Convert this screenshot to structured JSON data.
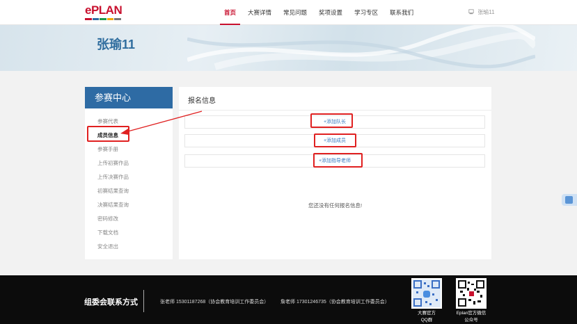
{
  "header": {
    "logo_text": "ePLAN",
    "nav": [
      "首页",
      "大赛详情",
      "常见问题",
      "奖项设置",
      "学习专区",
      "联系我们"
    ],
    "active_index": 0,
    "username": "张瑜11"
  },
  "banner": {
    "title": "张瑜11"
  },
  "sidebar": {
    "title": "参赛中心",
    "items": [
      {
        "label": "参赛代表",
        "active": false
      },
      {
        "label": "成员信息",
        "active": true
      },
      {
        "label": "参赛手册",
        "active": false
      },
      {
        "label": "上传初赛作品",
        "active": false
      },
      {
        "label": "上传决赛作品",
        "active": false
      },
      {
        "label": "初赛结果查询",
        "active": false
      },
      {
        "label": "决赛结果查询",
        "active": false
      },
      {
        "label": "密码修改",
        "active": false
      },
      {
        "label": "下载文档",
        "active": false
      },
      {
        "label": "安全退出",
        "active": false
      }
    ]
  },
  "panel": {
    "title": "报名信息",
    "add_leader": "+添加队长",
    "add_member": "+添加成员",
    "add_teacher": "+添加指导老师",
    "empty_text": "您还没有任何报名信息!"
  },
  "footer": {
    "title": "组委会联系方式",
    "contact1": "张老师 15301187268（协会教育培训工作委员会）",
    "contact2": "詹老师 17301246735（协会教育培训工作委员会）",
    "qr1_label_line1": "大赛官方",
    "qr1_label_line2": "QQ群",
    "qr2_label_line1": "Eplan官方微信",
    "qr2_label_line2": "公众号"
  },
  "colors": {
    "brand_red": "#c8102e",
    "sidebar_blue": "#2e6ba4",
    "link_blue": "#3a7bc0",
    "annotation_red": "#e02020"
  }
}
